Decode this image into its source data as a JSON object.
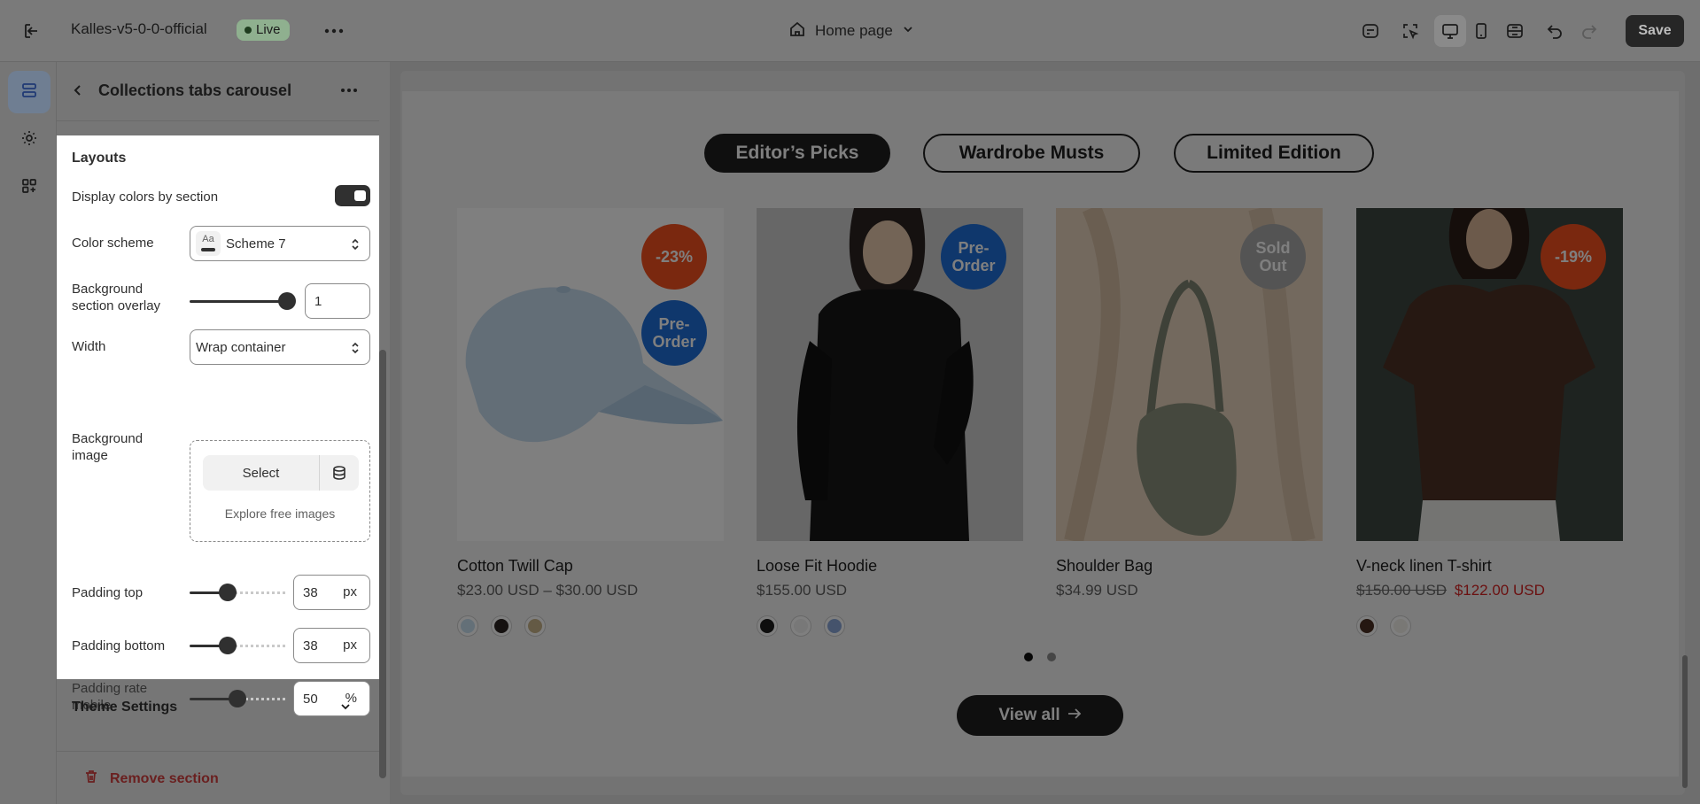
{
  "topbar": {
    "store_name": "Kalles-v5-0-0-official",
    "live_label": "Live",
    "page_label": "Home page",
    "save_label": "Save"
  },
  "sidebar": {
    "title": "Collections tabs carousel",
    "section_heading": "Layouts",
    "display_colors_label": "Display colors by section",
    "display_colors_on": true,
    "color_scheme_label": "Color scheme",
    "color_scheme_value": "Scheme 7",
    "color_scheme_chip": "Aa",
    "bg_overlay_label": "Background section overlay",
    "bg_overlay_value": "1",
    "bg_overlay_level": 1,
    "width_label": "Width",
    "width_value": "Wrap container",
    "bg_image_label": "Background image",
    "select_label": "Select",
    "explore_label": "Explore free images",
    "padding_top_label": "Padding top",
    "padding_top_value": "38",
    "padding_top_unit": "px",
    "padding_top_level": 0.38,
    "padding_bottom_label": "Padding bottom",
    "padding_bottom_value": "38",
    "padding_bottom_unit": "px",
    "padding_bottom_level": 0.38,
    "padding_rate_label": "Padding rate mobile",
    "padding_rate_value": "50",
    "padding_rate_unit": "%",
    "padding_rate_level": 0.5,
    "theme_settings_label": "Theme Settings",
    "remove_section_label": "Remove section"
  },
  "preview": {
    "tabs": [
      {
        "label": "Editor’s Picks",
        "active": true
      },
      {
        "label": "Wardrobe Musts",
        "active": false
      },
      {
        "label": "Limited Edition",
        "active": false
      }
    ],
    "products": [
      {
        "name": "Cotton Twill Cap",
        "price": "$23.00 USD – $30.00 USD",
        "old_price": "",
        "sale_price": "",
        "badges": [
          {
            "text": "-23%",
            "color": "#f4511e"
          },
          {
            "text": "Pre-Order",
            "color": "#1e6fd9"
          }
        ],
        "swatches": [
          "#c8e0f0",
          "#2b2220",
          "#c9b48a"
        ]
      },
      {
        "name": "Loose Fit Hoodie",
        "price": "$155.00 USD",
        "old_price": "",
        "sale_price": "",
        "badges": [
          {
            "text": "Pre-Order",
            "color": "#1e6fd9"
          }
        ],
        "swatches": [
          "#1c1c1c",
          "#f1f1f1",
          "#8aa7d8"
        ]
      },
      {
        "name": "Shoulder Bag",
        "price": "$34.99 USD",
        "old_price": "",
        "sale_price": "",
        "badges": [
          {
            "text": "Sold Out",
            "color": "#a8a8a8"
          }
        ],
        "swatches": []
      },
      {
        "name": "V-neck linen T-shirt",
        "price": "",
        "old_price": "$150.00 USD",
        "sale_price": "$122.00 USD",
        "badges": [
          {
            "text": "-19%",
            "color": "#f4511e"
          }
        ],
        "swatches": [
          "#4a2f22",
          "#f3f0ea"
        ]
      }
    ],
    "carousel_pages": 2,
    "carousel_current": 1,
    "view_all_label": "View all"
  },
  "colors": {
    "accent_dark": "#1f1f1f",
    "sale_red": "#d62222",
    "discount_orange": "#f4511e",
    "preorder_blue": "#1e6fd9"
  }
}
